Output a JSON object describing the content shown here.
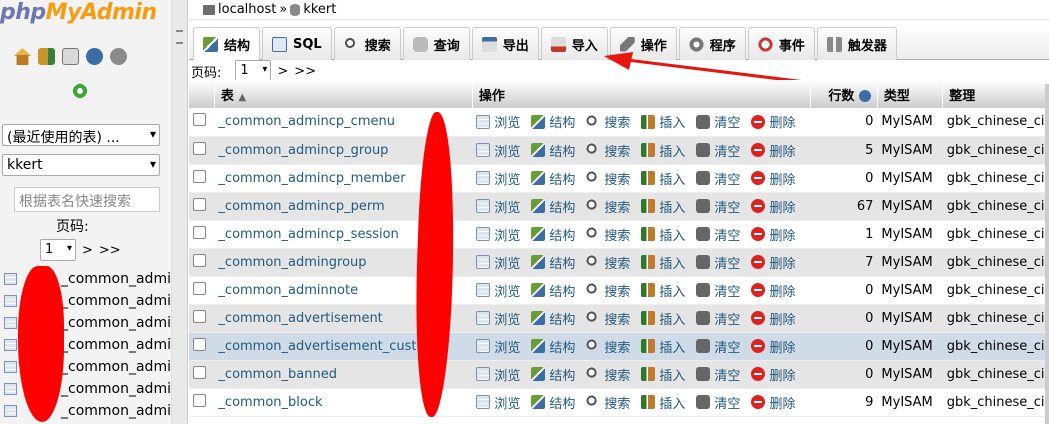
{
  "app": {
    "logo_php": "php",
    "logo_my": "MyAdmin"
  },
  "left": {
    "recent_select": "(最近使用的表) ...",
    "db_select": "kkert",
    "search_placeholder": "根据表名快速搜索",
    "page_label": "页码:",
    "page_value": "1",
    "next": ">",
    "last": ">>",
    "tables": [
      "_common_admi",
      "_common_admi",
      "_common_admi",
      "_common_admi",
      "_common_admi",
      "_common_admi",
      "_common_admi"
    ]
  },
  "breadcrumb": {
    "server": "localhost",
    "sep": "»",
    "db": "kkert"
  },
  "tabs": [
    {
      "label": "结构",
      "icon": "structure-icon",
      "color": "#3a7d3a"
    },
    {
      "label": "SQL",
      "icon": "sql-icon",
      "color": "#3a6ea5"
    },
    {
      "label": "搜索",
      "icon": "search-icon",
      "color": "#666666"
    },
    {
      "label": "查询",
      "icon": "query-icon",
      "color": "#888888"
    },
    {
      "label": "导出",
      "icon": "export-icon",
      "color": "#3a6ea5"
    },
    {
      "label": "导入",
      "icon": "import-icon",
      "color": "#c0392b"
    },
    {
      "label": "操作",
      "icon": "wrench-icon",
      "color": "#555555"
    },
    {
      "label": "程序",
      "icon": "routines-icon",
      "color": "#777777"
    },
    {
      "label": "事件",
      "icon": "clock-icon",
      "color": "#cc3333"
    },
    {
      "label": "触发器",
      "icon": "triggers-icon",
      "color": "#777777"
    }
  ],
  "pager": {
    "label": "页码:",
    "value": "1",
    "next": ">",
    "last": ">>"
  },
  "table_headers": {
    "table": "表",
    "action": "操作",
    "rows": "行数",
    "type": "类型",
    "collation": "整理"
  },
  "actions": {
    "browse": "浏览",
    "structure": "结构",
    "search": "搜索",
    "insert": "插入",
    "empty": "清空",
    "drop": "删除"
  },
  "rows": [
    {
      "name": "_common_admincp_cmenu",
      "rows": "0",
      "type": "MyISAM",
      "collation": "gbk_chinese_ci"
    },
    {
      "name": "_common_admincp_group",
      "rows": "5",
      "type": "MyISAM",
      "collation": "gbk_chinese_ci"
    },
    {
      "name": "_common_admincp_member",
      "rows": "0",
      "type": "MyISAM",
      "collation": "gbk_chinese_ci"
    },
    {
      "name": "_common_admincp_perm",
      "rows": "67",
      "type": "MyISAM",
      "collation": "gbk_chinese_ci"
    },
    {
      "name": "_common_admincp_session",
      "rows": "1",
      "type": "MyISAM",
      "collation": "gbk_chinese_ci"
    },
    {
      "name": "_common_admingroup",
      "rows": "7",
      "type": "MyISAM",
      "collation": "gbk_chinese_ci"
    },
    {
      "name": "_common_adminnote",
      "rows": "0",
      "type": "MyISAM",
      "collation": "gbk_chinese_ci"
    },
    {
      "name": "_common_advertisement",
      "rows": "0",
      "type": "MyISAM",
      "collation": "gbk_chinese_ci"
    },
    {
      "name": "_common_advertisement_custom",
      "rows": "0",
      "type": "MyISAM",
      "collation": "gbk_chinese_ci"
    },
    {
      "name": "_common_banned",
      "rows": "0",
      "type": "MyISAM",
      "collation": "gbk_chinese_ci"
    },
    {
      "name": "_common_block",
      "rows": "9",
      "type": "MyISAM",
      "collation": "gbk_chinese_ci"
    }
  ]
}
